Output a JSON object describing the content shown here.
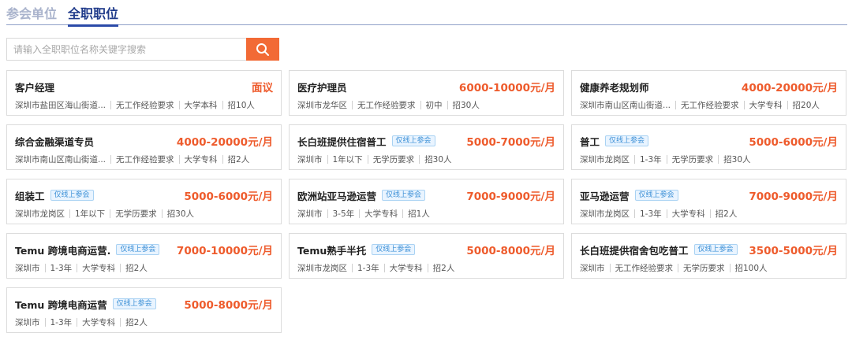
{
  "tabs": [
    {
      "label": "参会单位",
      "active": false
    },
    {
      "label": "全职职位",
      "active": true
    }
  ],
  "search": {
    "placeholder": "请输入全职职位名称关键字搜索",
    "button_icon": "search-icon"
  },
  "colors": {
    "accent": "#f26a35",
    "salary": "#ee5b2c",
    "tab_active": "#1f3a8a",
    "badge": "#3b8fd6"
  },
  "jobs": [
    {
      "title": "客户经理",
      "badge": "",
      "salary": "面议",
      "location": "深圳市盐田区海山街道...",
      "experience": "无工作经验要求",
      "education": "大学本科",
      "headcount": "招10人"
    },
    {
      "title": "医疗护理员",
      "badge": "",
      "salary": "6000-10000元/月",
      "location": "深圳市龙华区",
      "experience": "无工作经验要求",
      "education": "初中",
      "headcount": "招30人"
    },
    {
      "title": "健康养老规划师",
      "badge": "",
      "salary": "4000-20000元/月",
      "location": "深圳市南山区南山街道...",
      "experience": "无工作经验要求",
      "education": "大学专科",
      "headcount": "招20人"
    },
    {
      "title": "综合金融渠道专员",
      "badge": "",
      "salary": "4000-20000元/月",
      "location": "深圳市南山区南山街道...",
      "experience": "无工作经验要求",
      "education": "大学专科",
      "headcount": "招2人"
    },
    {
      "title": "长白班提供住宿普工",
      "badge": "仅线上参会",
      "salary": "5000-7000元/月",
      "location": "深圳市",
      "experience": "1年以下",
      "education": "无学历要求",
      "headcount": "招30人"
    },
    {
      "title": "普工",
      "badge": "仅线上参会",
      "salary": "5000-6000元/月",
      "location": "深圳市龙岗区",
      "experience": "1-3年",
      "education": "无学历要求",
      "headcount": "招30人"
    },
    {
      "title": "组装工",
      "badge": "仅线上参会",
      "salary": "5000-6000元/月",
      "location": "深圳市龙岗区",
      "experience": "1年以下",
      "education": "无学历要求",
      "headcount": "招30人"
    },
    {
      "title": "欧洲站亚马逊运营",
      "badge": "仅线上参会",
      "salary": "7000-9000元/月",
      "location": "深圳市",
      "experience": "3-5年",
      "education": "大学专科",
      "headcount": "招1人"
    },
    {
      "title": "亚马逊运营",
      "badge": "仅线上参会",
      "salary": "7000-9000元/月",
      "location": "深圳市龙岗区",
      "experience": "1-3年",
      "education": "大学专科",
      "headcount": "招2人"
    },
    {
      "title": "Temu 跨境电商运营.",
      "badge": "仅线上参会",
      "salary": "7000-10000元/月",
      "location": "深圳市",
      "experience": "1-3年",
      "education": "大学专科",
      "headcount": "招2人"
    },
    {
      "title": "Temu熟手半托",
      "badge": "仅线上参会",
      "salary": "5000-8000元/月",
      "location": "深圳市龙岗区",
      "experience": "1-3年",
      "education": "大学专科",
      "headcount": "招2人"
    },
    {
      "title": "长白班提供宿舍包吃普工",
      "badge": "仅线上参会",
      "salary": "3500-5000元/月",
      "location": "深圳市",
      "experience": "无工作经验要求",
      "education": "无学历要求",
      "headcount": "招100人"
    },
    {
      "title": "Temu 跨境电商运营",
      "badge": "仅线上参会",
      "salary": "5000-8000元/月",
      "location": "深圳市",
      "experience": "1-3年",
      "education": "大学专科",
      "headcount": "招2人"
    }
  ]
}
